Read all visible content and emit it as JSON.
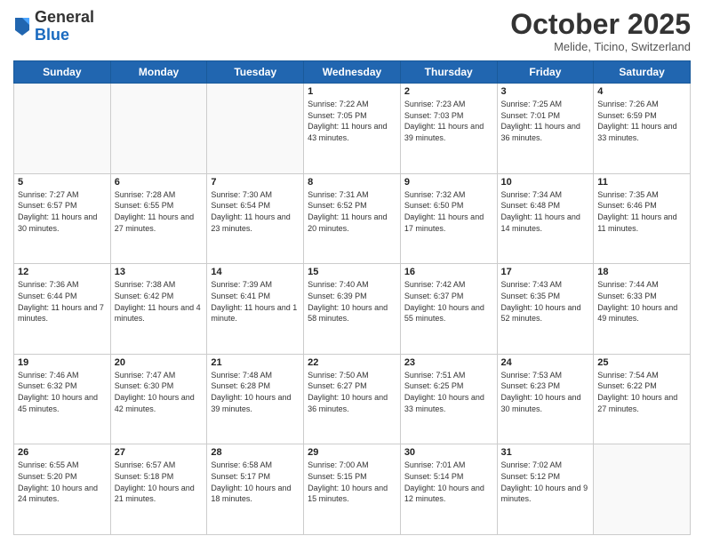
{
  "header": {
    "logo_general": "General",
    "logo_blue": "Blue",
    "month_title": "October 2025",
    "location": "Melide, Ticino, Switzerland"
  },
  "days_of_week": [
    "Sunday",
    "Monday",
    "Tuesday",
    "Wednesday",
    "Thursday",
    "Friday",
    "Saturday"
  ],
  "weeks": [
    [
      {
        "day": "",
        "info": ""
      },
      {
        "day": "",
        "info": ""
      },
      {
        "day": "",
        "info": ""
      },
      {
        "day": "1",
        "info": "Sunrise: 7:22 AM\nSunset: 7:05 PM\nDaylight: 11 hours and 43 minutes."
      },
      {
        "day": "2",
        "info": "Sunrise: 7:23 AM\nSunset: 7:03 PM\nDaylight: 11 hours and 39 minutes."
      },
      {
        "day": "3",
        "info": "Sunrise: 7:25 AM\nSunset: 7:01 PM\nDaylight: 11 hours and 36 minutes."
      },
      {
        "day": "4",
        "info": "Sunrise: 7:26 AM\nSunset: 6:59 PM\nDaylight: 11 hours and 33 minutes."
      }
    ],
    [
      {
        "day": "5",
        "info": "Sunrise: 7:27 AM\nSunset: 6:57 PM\nDaylight: 11 hours and 30 minutes."
      },
      {
        "day": "6",
        "info": "Sunrise: 7:28 AM\nSunset: 6:55 PM\nDaylight: 11 hours and 27 minutes."
      },
      {
        "day": "7",
        "info": "Sunrise: 7:30 AM\nSunset: 6:54 PM\nDaylight: 11 hours and 23 minutes."
      },
      {
        "day": "8",
        "info": "Sunrise: 7:31 AM\nSunset: 6:52 PM\nDaylight: 11 hours and 20 minutes."
      },
      {
        "day": "9",
        "info": "Sunrise: 7:32 AM\nSunset: 6:50 PM\nDaylight: 11 hours and 17 minutes."
      },
      {
        "day": "10",
        "info": "Sunrise: 7:34 AM\nSunset: 6:48 PM\nDaylight: 11 hours and 14 minutes."
      },
      {
        "day": "11",
        "info": "Sunrise: 7:35 AM\nSunset: 6:46 PM\nDaylight: 11 hours and 11 minutes."
      }
    ],
    [
      {
        "day": "12",
        "info": "Sunrise: 7:36 AM\nSunset: 6:44 PM\nDaylight: 11 hours and 7 minutes."
      },
      {
        "day": "13",
        "info": "Sunrise: 7:38 AM\nSunset: 6:42 PM\nDaylight: 11 hours and 4 minutes."
      },
      {
        "day": "14",
        "info": "Sunrise: 7:39 AM\nSunset: 6:41 PM\nDaylight: 11 hours and 1 minute."
      },
      {
        "day": "15",
        "info": "Sunrise: 7:40 AM\nSunset: 6:39 PM\nDaylight: 10 hours and 58 minutes."
      },
      {
        "day": "16",
        "info": "Sunrise: 7:42 AM\nSunset: 6:37 PM\nDaylight: 10 hours and 55 minutes."
      },
      {
        "day": "17",
        "info": "Sunrise: 7:43 AM\nSunset: 6:35 PM\nDaylight: 10 hours and 52 minutes."
      },
      {
        "day": "18",
        "info": "Sunrise: 7:44 AM\nSunset: 6:33 PM\nDaylight: 10 hours and 49 minutes."
      }
    ],
    [
      {
        "day": "19",
        "info": "Sunrise: 7:46 AM\nSunset: 6:32 PM\nDaylight: 10 hours and 45 minutes."
      },
      {
        "day": "20",
        "info": "Sunrise: 7:47 AM\nSunset: 6:30 PM\nDaylight: 10 hours and 42 minutes."
      },
      {
        "day": "21",
        "info": "Sunrise: 7:48 AM\nSunset: 6:28 PM\nDaylight: 10 hours and 39 minutes."
      },
      {
        "day": "22",
        "info": "Sunrise: 7:50 AM\nSunset: 6:27 PM\nDaylight: 10 hours and 36 minutes."
      },
      {
        "day": "23",
        "info": "Sunrise: 7:51 AM\nSunset: 6:25 PM\nDaylight: 10 hours and 33 minutes."
      },
      {
        "day": "24",
        "info": "Sunrise: 7:53 AM\nSunset: 6:23 PM\nDaylight: 10 hours and 30 minutes."
      },
      {
        "day": "25",
        "info": "Sunrise: 7:54 AM\nSunset: 6:22 PM\nDaylight: 10 hours and 27 minutes."
      }
    ],
    [
      {
        "day": "26",
        "info": "Sunrise: 6:55 AM\nSunset: 5:20 PM\nDaylight: 10 hours and 24 minutes."
      },
      {
        "day": "27",
        "info": "Sunrise: 6:57 AM\nSunset: 5:18 PM\nDaylight: 10 hours and 21 minutes."
      },
      {
        "day": "28",
        "info": "Sunrise: 6:58 AM\nSunset: 5:17 PM\nDaylight: 10 hours and 18 minutes."
      },
      {
        "day": "29",
        "info": "Sunrise: 7:00 AM\nSunset: 5:15 PM\nDaylight: 10 hours and 15 minutes."
      },
      {
        "day": "30",
        "info": "Sunrise: 7:01 AM\nSunset: 5:14 PM\nDaylight: 10 hours and 12 minutes."
      },
      {
        "day": "31",
        "info": "Sunrise: 7:02 AM\nSunset: 5:12 PM\nDaylight: 10 hours and 9 minutes."
      },
      {
        "day": "",
        "info": ""
      }
    ]
  ]
}
